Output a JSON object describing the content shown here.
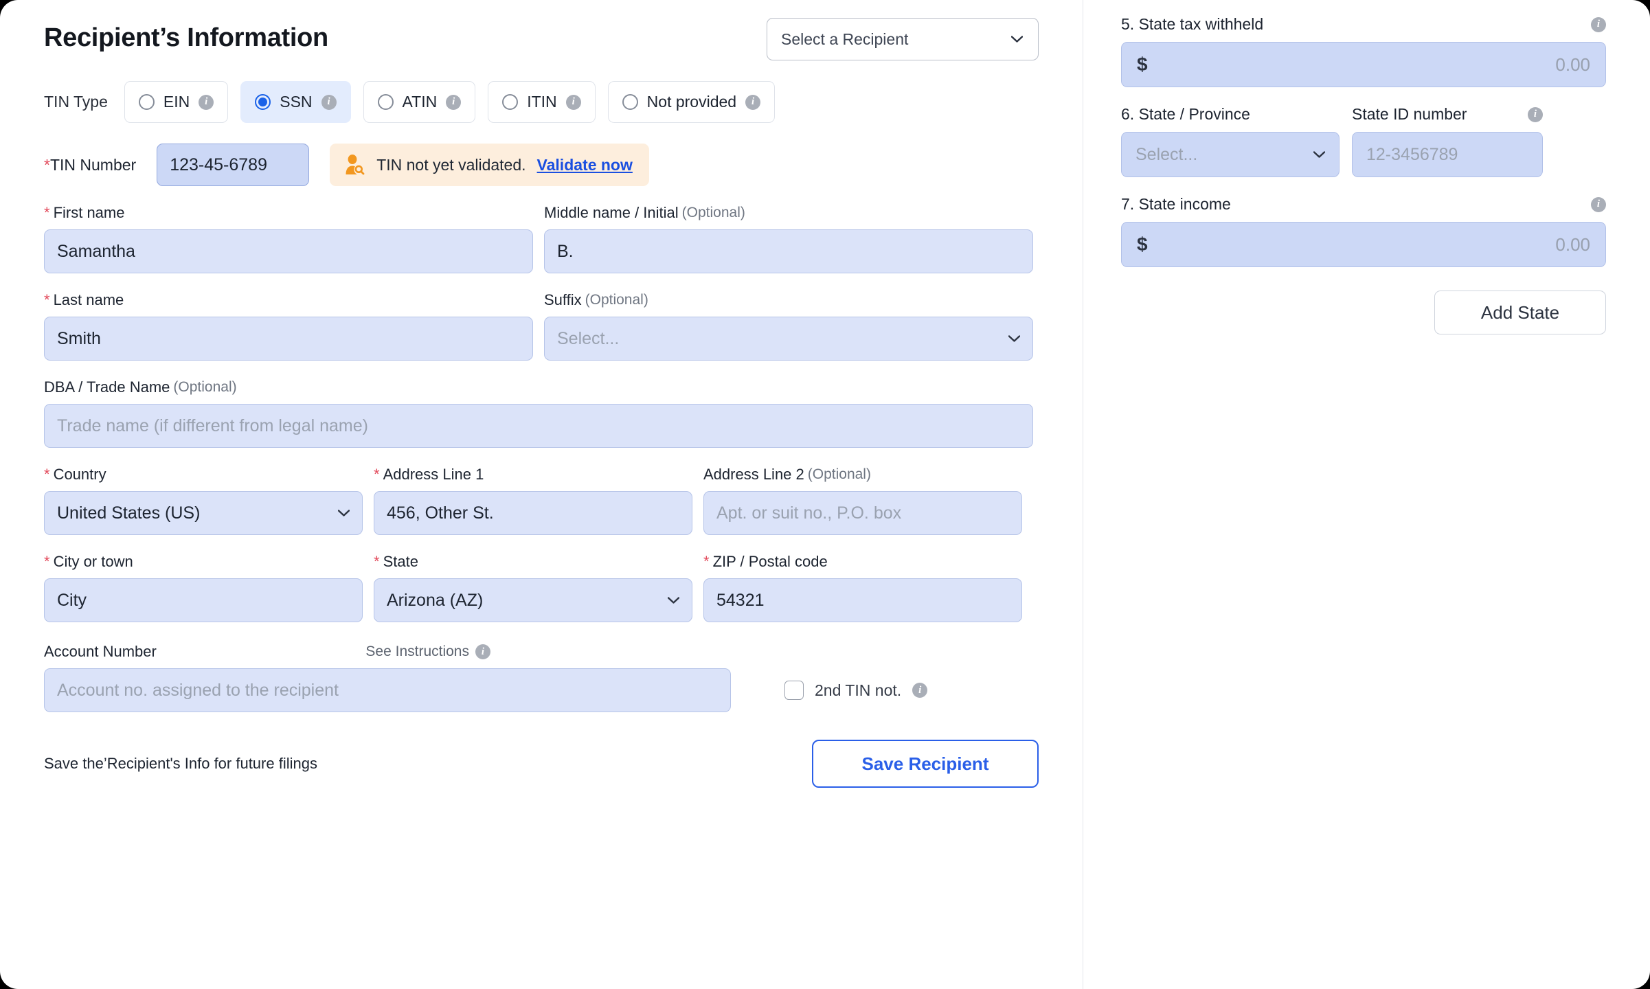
{
  "header": {
    "title": "Recipient’s Information",
    "recipient_select_value": "Select a Recipient"
  },
  "tin_type": {
    "label": "TIN Type",
    "options": [
      {
        "label": "EIN",
        "selected": false
      },
      {
        "label": "SSN",
        "selected": true
      },
      {
        "label": "ATIN",
        "selected": false
      },
      {
        "label": "ITIN",
        "selected": false
      },
      {
        "label": "Not provided",
        "selected": false
      }
    ]
  },
  "tin_number": {
    "label": "TIN Number",
    "required": true,
    "value": "123-45-6789",
    "warning_text": "TIN not yet validated.",
    "warning_link": "Validate now"
  },
  "name_fields": {
    "first_name_label": "First name",
    "first_name_value": "Samantha",
    "middle_name_label": "Middle name / Initial",
    "middle_name_optional": "(Optional)",
    "middle_name_value": "B.",
    "last_name_label": "Last name",
    "last_name_value": "Smith",
    "suffix_label": "Suffix",
    "suffix_optional": "(Optional)",
    "suffix_value": "Select..."
  },
  "dba": {
    "label": "DBA / Trade Name",
    "optional": "(Optional)",
    "placeholder": "Trade name (if different from legal name)"
  },
  "address": {
    "country_label": "Country",
    "country_value": "United States (US)",
    "line1_label": "Address Line 1",
    "line1_value": "456, Other St.",
    "line2_label": "Address Line 2",
    "line2_optional": "(Optional)",
    "line2_placeholder": "Apt. or suit no., P.O. box",
    "city_label": "City or town",
    "city_value": "City",
    "state_label": "State",
    "state_value": "Arizona (AZ)",
    "zip_label": "ZIP / Postal code",
    "zip_value": "54321"
  },
  "account": {
    "label": "Account Number",
    "see_instructions": "See Instructions",
    "placeholder": "Account no. assigned to the recipient",
    "second_tin_label": "2nd TIN not.",
    "second_tin_checked": false
  },
  "footer": {
    "note": "Save the’Recipient's Info for future filings",
    "save_button": "Save Recipient"
  },
  "state_panel": {
    "tax_withheld_label": "5. State tax withheld",
    "tax_withheld_currency": "$",
    "tax_withheld_value": "0.00",
    "state_province_label": "6. State / Province",
    "state_province_value": "Select...",
    "state_id_label": "State ID number",
    "state_id_placeholder": "12-3456789",
    "state_income_label": "7. State income",
    "state_income_currency": "$",
    "state_income_value": "0.00",
    "add_state_button": "Add State"
  },
  "colors": {
    "accent_blue": "#2a5fe8",
    "input_fill": "#dbe3f9",
    "warning_bg": "#fdeedd",
    "required_star": "#e2495b"
  }
}
